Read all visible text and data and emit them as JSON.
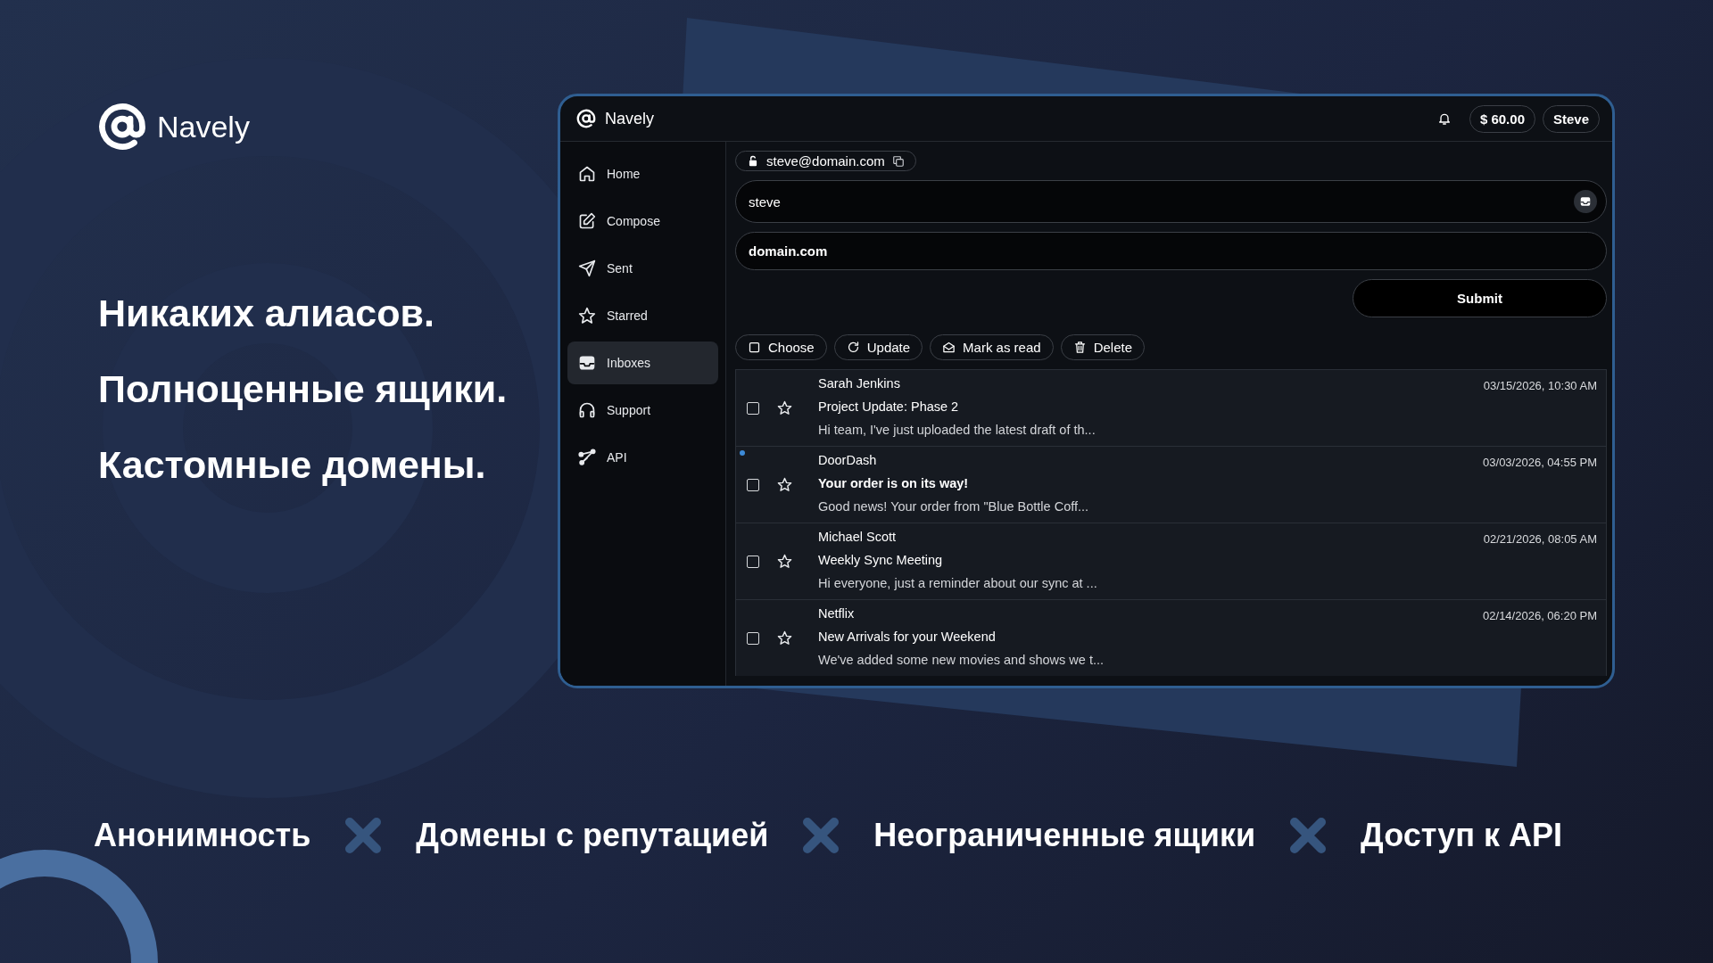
{
  "brand": {
    "name": "Navely"
  },
  "headlines": [
    "Никаких алиасов.",
    "Полноценные ящики.",
    "Кастомные домены."
  ],
  "features": [
    "Анонимность",
    "Домены с репутацией",
    "Неограниченные ящики",
    "Доступ к API"
  ],
  "app": {
    "title": "Navely",
    "balance": "$ 60.00",
    "user": "Steve",
    "sidebar": [
      {
        "label": "Home",
        "kind": "home",
        "selected": false
      },
      {
        "label": "Compose",
        "kind": "compose",
        "selected": false
      },
      {
        "label": "Sent",
        "kind": "sent",
        "selected": false
      },
      {
        "label": "Starred",
        "kind": "starred",
        "selected": false
      },
      {
        "label": "Inboxes",
        "kind": "inboxes",
        "selected": true
      },
      {
        "label": "Support",
        "kind": "support",
        "selected": false
      },
      {
        "label": "API",
        "kind": "api",
        "selected": false
      }
    ],
    "address": "steve@domain.com",
    "fields": [
      {
        "value": "steve",
        "kind": "plain"
      },
      {
        "value": "domain.com",
        "kind": "bold"
      }
    ],
    "submit": "Submit",
    "toolbar": [
      {
        "label": "Choose",
        "kind": "checkbox"
      },
      {
        "label": "Update",
        "kind": "refresh"
      },
      {
        "label": "Mark as read",
        "kind": "envelope"
      },
      {
        "label": "Delete",
        "kind": "trash"
      }
    ],
    "messages": [
      {
        "sender": "Sarah Jenkins",
        "subject": "Project Update: Phase 2",
        "preview": "Hi team, I've just uploaded the latest draft of th...",
        "date": "03/15/2026, 10:30 AM",
        "unread": false,
        "checked": false,
        "starred": false
      },
      {
        "sender": "DoorDash",
        "subject": "Your order is on its way!",
        "preview": "Good news! Your order from \"Blue Bottle Coff...",
        "date": "03/03/2026, 04:55 PM",
        "unread": true,
        "checked": false,
        "starred": false
      },
      {
        "sender": "Michael Scott",
        "subject": "Weekly Sync Meeting",
        "preview": "Hi everyone, just a reminder about our sync at ...",
        "date": "02/21/2026, 08:05 AM",
        "unread": false,
        "checked": false,
        "starred": false
      },
      {
        "sender": "Netflix",
        "subject": "New Arrivals for your Weekend",
        "preview": "We've added some new movies and shows we t...",
        "date": "02/14/2026, 06:20 PM",
        "unread": false,
        "checked": false,
        "starred": false
      }
    ]
  }
}
